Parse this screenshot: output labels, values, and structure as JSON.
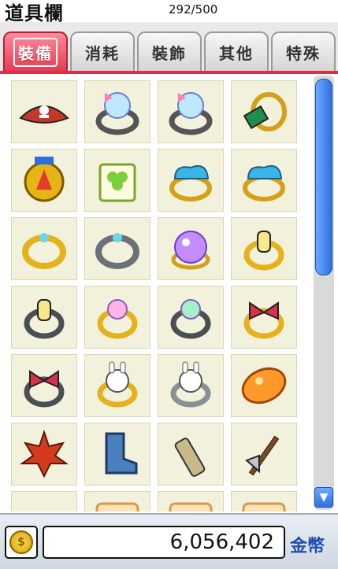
{
  "header": {
    "title": "道具欄",
    "capacity": "292/500"
  },
  "tabs": [
    {
      "label": "裝備",
      "active": true
    },
    {
      "label": "消耗",
      "active": false
    },
    {
      "label": "裝飾",
      "active": false
    },
    {
      "label": "其他",
      "active": false
    },
    {
      "label": "特殊",
      "active": false
    }
  ],
  "colors": {
    "accent": "#d8314a",
    "scroll": "#2d6fe0",
    "slot_bg": "#f2f1dc"
  },
  "items": [
    "pirate-hat-icon",
    "crystal-ring-pink-icon",
    "crystal-ring-pink-icon",
    "emerald-ring-icon",
    "medal-icon",
    "clover-badge-icon",
    "cloud-ring-icon",
    "cloud-ring-icon",
    "gold-ring-icon",
    "silver-ring-icon",
    "magic-orb-icon",
    "potion-ring-icon",
    "potion-ring-dark-icon",
    "rainbow-ring-gold-icon",
    "rainbow-ring-silver-icon",
    "ribbon-ring-icon",
    "ribbon-ring-dark-icon",
    "bunny-ring-gold-icon",
    "bunny-ring-silver-icon",
    "orange-gem-icon",
    "maple-leaf-icon",
    "blue-boot-icon",
    "bullet-icon",
    "axe-icon",
    "dark-item-icon",
    "card-item-icon",
    "card-item-icon",
    "card-item-icon"
  ],
  "footer": {
    "money": "6,056,402",
    "money_label": "金幣",
    "coin_glyph": "$"
  },
  "scroll": {
    "down_glyph": "▼"
  }
}
